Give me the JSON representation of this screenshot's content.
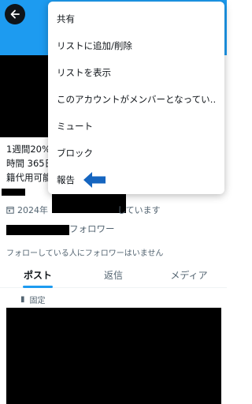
{
  "header": {
    "back_icon": "arrow-left-icon",
    "color": "#1d9bf0"
  },
  "bio": {
    "line1": "1週間20%",
    "line2": "時間 365日",
    "line3": "籍代用可能"
  },
  "profile": {
    "joined_prefix": "2024年",
    "joined_suffix": "しています",
    "followers_label": "フォロワー",
    "no_mutual_followers": "フォローしている人にフォロワーはいません",
    "pinned_label": "固定"
  },
  "tabs": [
    {
      "label": "ポスト",
      "active": true
    },
    {
      "label": "返信",
      "active": false
    },
    {
      "label": "メディア",
      "active": false
    }
  ],
  "menu": {
    "items": [
      "共有",
      "リストに追加/削除",
      "リストを表示",
      "このアカウントがメンバーとなってい‥",
      "ミュート",
      "ブロック",
      "報告"
    ],
    "annotation": {
      "icon": "left-arrow-pointer-icon",
      "color": "#1565c0"
    }
  }
}
